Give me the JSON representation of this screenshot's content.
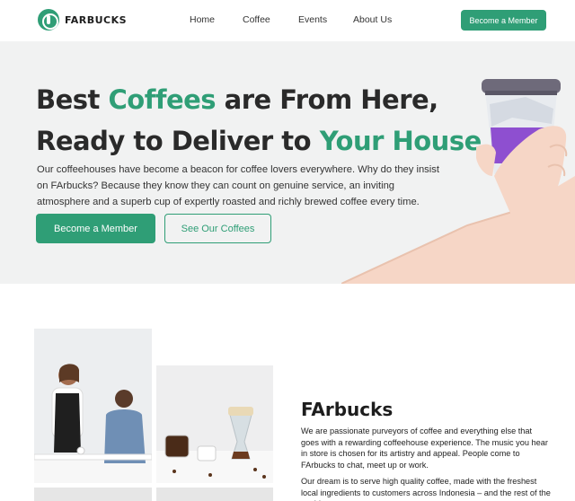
{
  "brand": {
    "name": "FARBUCKS",
    "logo_icon": "coffee-bean-icon"
  },
  "nav": {
    "links": [
      "Home",
      "Coffee",
      "Events",
      "About Us"
    ],
    "cta_label": "Become a Member"
  },
  "hero": {
    "title_line1_pre": "Best ",
    "title_line1_accent": "Coffees",
    "title_line1_post": " are From Here,",
    "title_line2_pre": "Ready to Deliver to ",
    "title_line2_accent": "Your House",
    "description": "Our coffeehouses have become a beacon for coffee lovers everywhere. Why do they insist on FArbucks? Because they know they can count on genuine service, an inviting atmosphere and a superb cup of expertly roasted and richly brewed coffee every time.",
    "primary_button": "Become a Member",
    "secondary_button": "See Our Coffees"
  },
  "about": {
    "title": "FArbucks",
    "paragraph1": "We are passionate purveyors of coffee and everything else that goes with a rewarding coffeehouse experience. The music you hear in store is chosen for its artistry and appeal. People come to FArbucks to chat, meet up or work.",
    "paragraph2": "Our dream is to serve high quality coffee, made with the freshest local ingredients to customers across Indonesia – and the rest of the world."
  },
  "colors": {
    "accent": "#2f9e76",
    "hero_bg": "#f1f2f2",
    "cup_lid": "#6e6a7a",
    "cup_sleeve": "#8e4fd0"
  }
}
